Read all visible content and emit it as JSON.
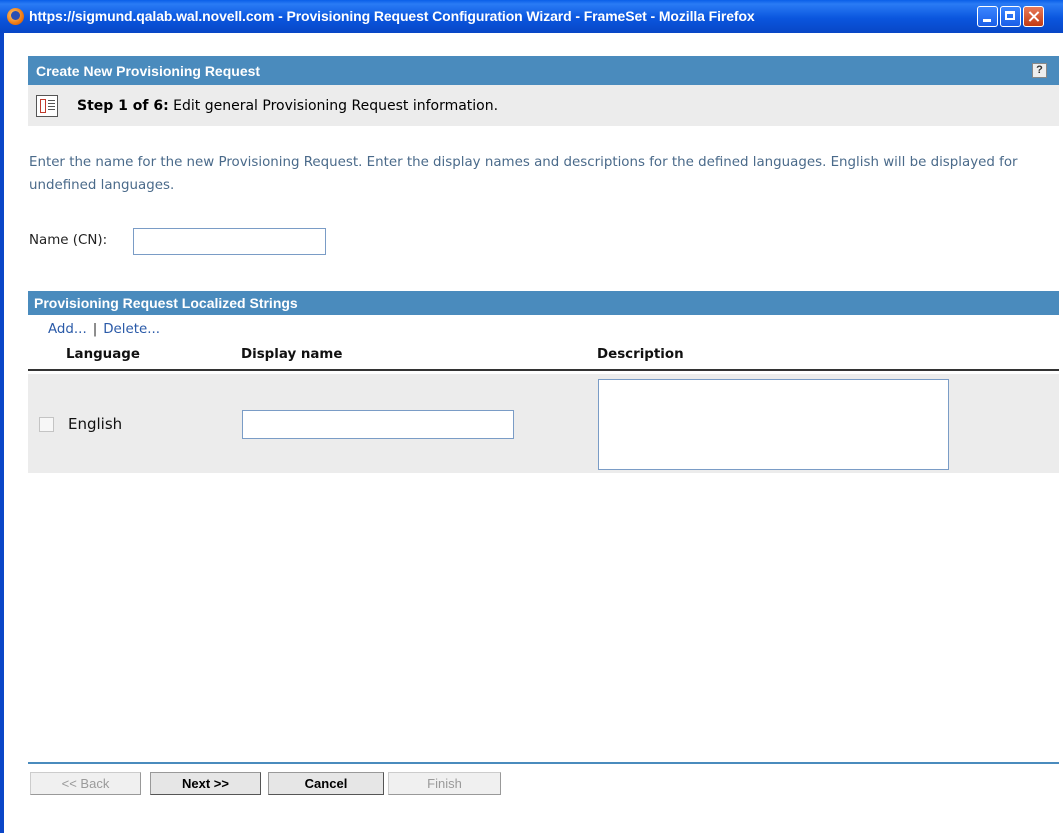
{
  "window": {
    "title": "https://sigmund.qalab.wal.novell.com - Provisioning Request Configuration Wizard - FrameSet - Mozilla Firefox"
  },
  "header": {
    "title": "Create New Provisioning Request",
    "help": "?"
  },
  "step": {
    "label": "Step 1 of 6:",
    "text": "Edit general Provisioning Request information."
  },
  "intro": "Enter the name for the new Provisioning Request.  Enter the display names and descriptions for the defined languages.  English will be displayed for undefined languages.",
  "name_field": {
    "label": "Name (CN):",
    "value": ""
  },
  "localized": {
    "title": "Provisioning Request Localized Strings",
    "actions": {
      "add": "Add...",
      "separator": "|",
      "delete": "Delete..."
    },
    "columns": [
      "Language",
      "Display name",
      "Description"
    ],
    "rows": [
      {
        "language": "English",
        "display_name": "",
        "description": ""
      }
    ]
  },
  "buttons": {
    "back": "<< Back",
    "next": "Next >>",
    "cancel": "Cancel",
    "finish": "Finish"
  }
}
